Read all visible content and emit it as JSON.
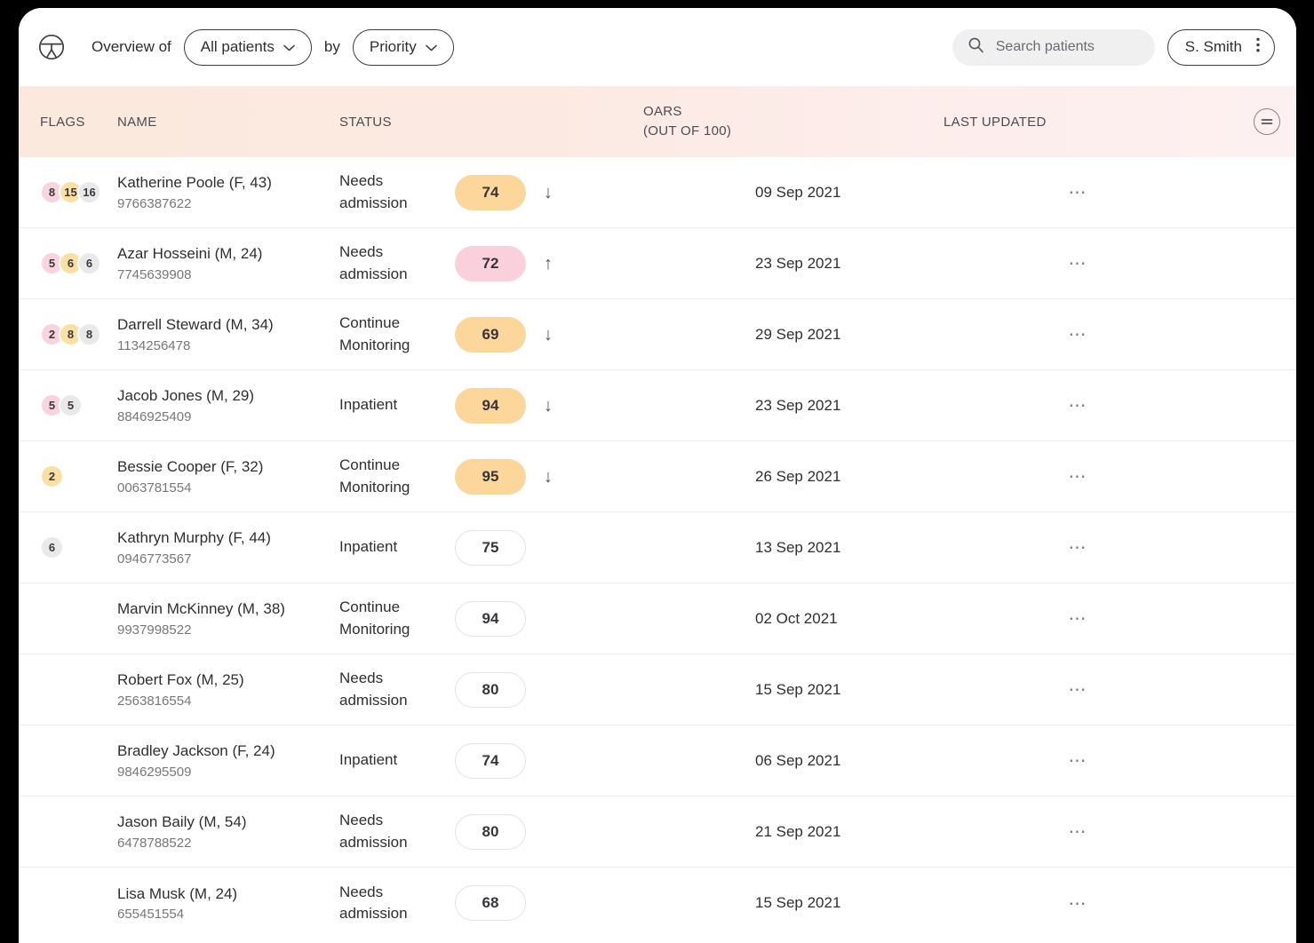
{
  "header": {
    "logo_icon": "patient-circle-logo",
    "overview_label": "Overview of",
    "patients_filter": "All patients",
    "by_label": "by",
    "sort_filter": "Priority",
    "search_placeholder": "Search patients",
    "search_value": "",
    "search_icon": "search-icon",
    "user_name": "S. Smith",
    "user_menu_icon": "kebab-menu-icon",
    "chevron_icon": "chevron-down-icon"
  },
  "table": {
    "columns": {
      "flags": "FLAGS",
      "name": "NAME",
      "status": "STATUS",
      "oars_line1": "OARS",
      "oars_line2": "(OUT OF 100)",
      "last_updated": "LAST UPDATED"
    },
    "filter_icon": "filter-lines-icon",
    "row_menu_icon": "ellipsis-icon",
    "rows": [
      {
        "flags": [
          {
            "value": "8",
            "color": "pink"
          },
          {
            "value": "15",
            "color": "yellow"
          },
          {
            "value": "16",
            "color": "grey"
          }
        ],
        "name": "Katherine Poole (F, 43)",
        "id": "9766387622",
        "status": "Needs admission",
        "oars": "74",
        "oars_style": "orange",
        "trend": "↓",
        "last_updated": "09 Sep 2021"
      },
      {
        "flags": [
          {
            "value": "5",
            "color": "pink"
          },
          {
            "value": "6",
            "color": "yellow"
          },
          {
            "value": "6",
            "color": "grey"
          }
        ],
        "name": "Azar Hosseini (M, 24)",
        "id": "7745639908",
        "status": "Needs admission",
        "oars": "72",
        "oars_style": "pink",
        "trend": "↑",
        "last_updated": "23 Sep 2021"
      },
      {
        "flags": [
          {
            "value": "2",
            "color": "pink"
          },
          {
            "value": "8",
            "color": "yellow"
          },
          {
            "value": "8",
            "color": "grey"
          }
        ],
        "name": "Darrell Steward (M, 34)",
        "id": "1134256478",
        "status": "Continue Monitoring",
        "oars": "69",
        "oars_style": "orange",
        "trend": "↓",
        "last_updated": "29 Sep 2021"
      },
      {
        "flags": [
          {
            "value": "5",
            "color": "pink"
          },
          {
            "value": "5",
            "color": "grey"
          }
        ],
        "name": "Jacob Jones (M, 29)",
        "id": "8846925409",
        "status": "Inpatient",
        "oars": "94",
        "oars_style": "orange",
        "trend": "↓",
        "last_updated": "23 Sep 2021"
      },
      {
        "flags": [
          {
            "value": "2",
            "color": "yellow"
          }
        ],
        "name": "Bessie Cooper (F, 32)",
        "id": "0063781554",
        "status": "Continue Monitoring",
        "oars": "95",
        "oars_style": "orange",
        "trend": "↓",
        "last_updated": "26 Sep 2021"
      },
      {
        "flags": [
          {
            "value": "6",
            "color": "grey"
          }
        ],
        "name": "Kathryn Murphy (F, 44)",
        "id": "0946773567",
        "status": "Inpatient",
        "oars": "75",
        "oars_style": "plain",
        "trend": "",
        "last_updated": "13 Sep 2021"
      },
      {
        "flags": [],
        "name": "Marvin McKinney (M, 38)",
        "id": "9937998522",
        "status": "Continue Monitoring",
        "oars": "94",
        "oars_style": "plain",
        "trend": "",
        "last_updated": "02 Oct 2021"
      },
      {
        "flags": [],
        "name": "Robert Fox (M, 25)",
        "id": "2563816554",
        "status": "Needs admission",
        "oars": "80",
        "oars_style": "plain",
        "trend": "",
        "last_updated": "15 Sep 2021"
      },
      {
        "flags": [],
        "name": "Bradley Jackson (F, 24)",
        "id": "9846295509",
        "status": "Inpatient",
        "oars": "74",
        "oars_style": "plain",
        "trend": "",
        "last_updated": "06 Sep 2021"
      },
      {
        "flags": [],
        "name": "Jason Baily (M, 54)",
        "id": "6478788522",
        "status": "Needs admission",
        "oars": "80",
        "oars_style": "plain",
        "trend": "",
        "last_updated": "21 Sep 2021"
      },
      {
        "flags": [],
        "name": "Lisa Musk (M, 24)",
        "id": "655451554",
        "status": "Needs admission",
        "oars": "68",
        "oars_style": "plain",
        "trend": "",
        "last_updated": "15 Sep 2021"
      }
    ]
  },
  "colors": {
    "header_gradient_start": "#fbe9dd",
    "header_gradient_end": "#fdf0f0",
    "flag_pink": "#f9d3dd",
    "flag_yellow": "#fbdfa3",
    "flag_grey": "#e9e9ea",
    "score_orange": "#fcd69b",
    "score_pink": "#fbd0dd"
  }
}
